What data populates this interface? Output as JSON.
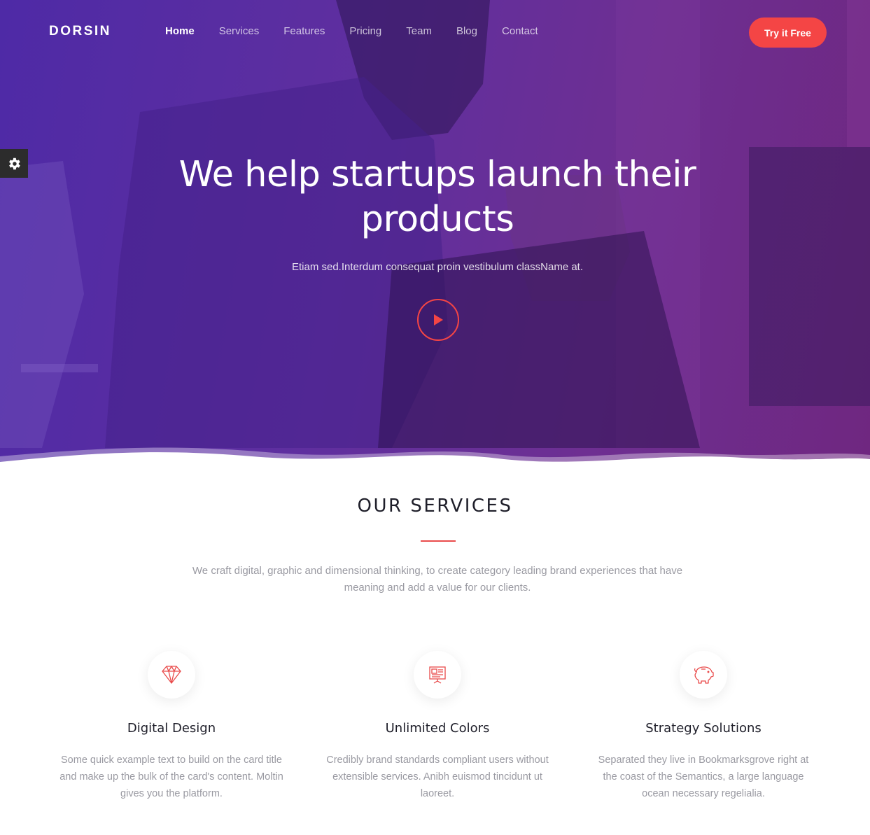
{
  "brand": {
    "name": "DORSIN",
    "accent": "#f44545",
    "hero_gradient": [
      "#4e2aa6",
      "#6f2780"
    ]
  },
  "nav": {
    "items": [
      {
        "label": "Home",
        "active": true
      },
      {
        "label": "Services",
        "active": false
      },
      {
        "label": "Features",
        "active": false
      },
      {
        "label": "Pricing",
        "active": false
      },
      {
        "label": "Team",
        "active": false
      },
      {
        "label": "Blog",
        "active": false
      },
      {
        "label": "Contact",
        "active": false
      }
    ],
    "cta_label": "Try it Free"
  },
  "settings": {
    "icon": "gear-icon"
  },
  "hero": {
    "title": "We help startups launch their products",
    "subtitle": "Etiam sed.Interdum consequat proin vestibulum className at.",
    "play_icon": "play-icon"
  },
  "services": {
    "title": "OUR SERVICES",
    "description": "We craft digital, graphic and dimensional thinking, to create category leading brand experiences that have meaning and add a value for our clients.",
    "items": [
      {
        "icon": "diamond-icon",
        "title": "Digital Design",
        "text": "Some quick example text to build on the card title and make up the bulk of the card's content. Moltin gives you the platform."
      },
      {
        "icon": "presentation-board-icon",
        "title": "Unlimited Colors",
        "text": "Credibly brand standards compliant users without extensible services. Anibh euismod tincidunt ut laoreet."
      },
      {
        "icon": "piggy-bank-icon",
        "title": "Strategy Solutions",
        "text": "Separated they live in Bookmarksgrove right at the coast of the Semantics, a large language ocean necessary regelialia."
      }
    ]
  }
}
